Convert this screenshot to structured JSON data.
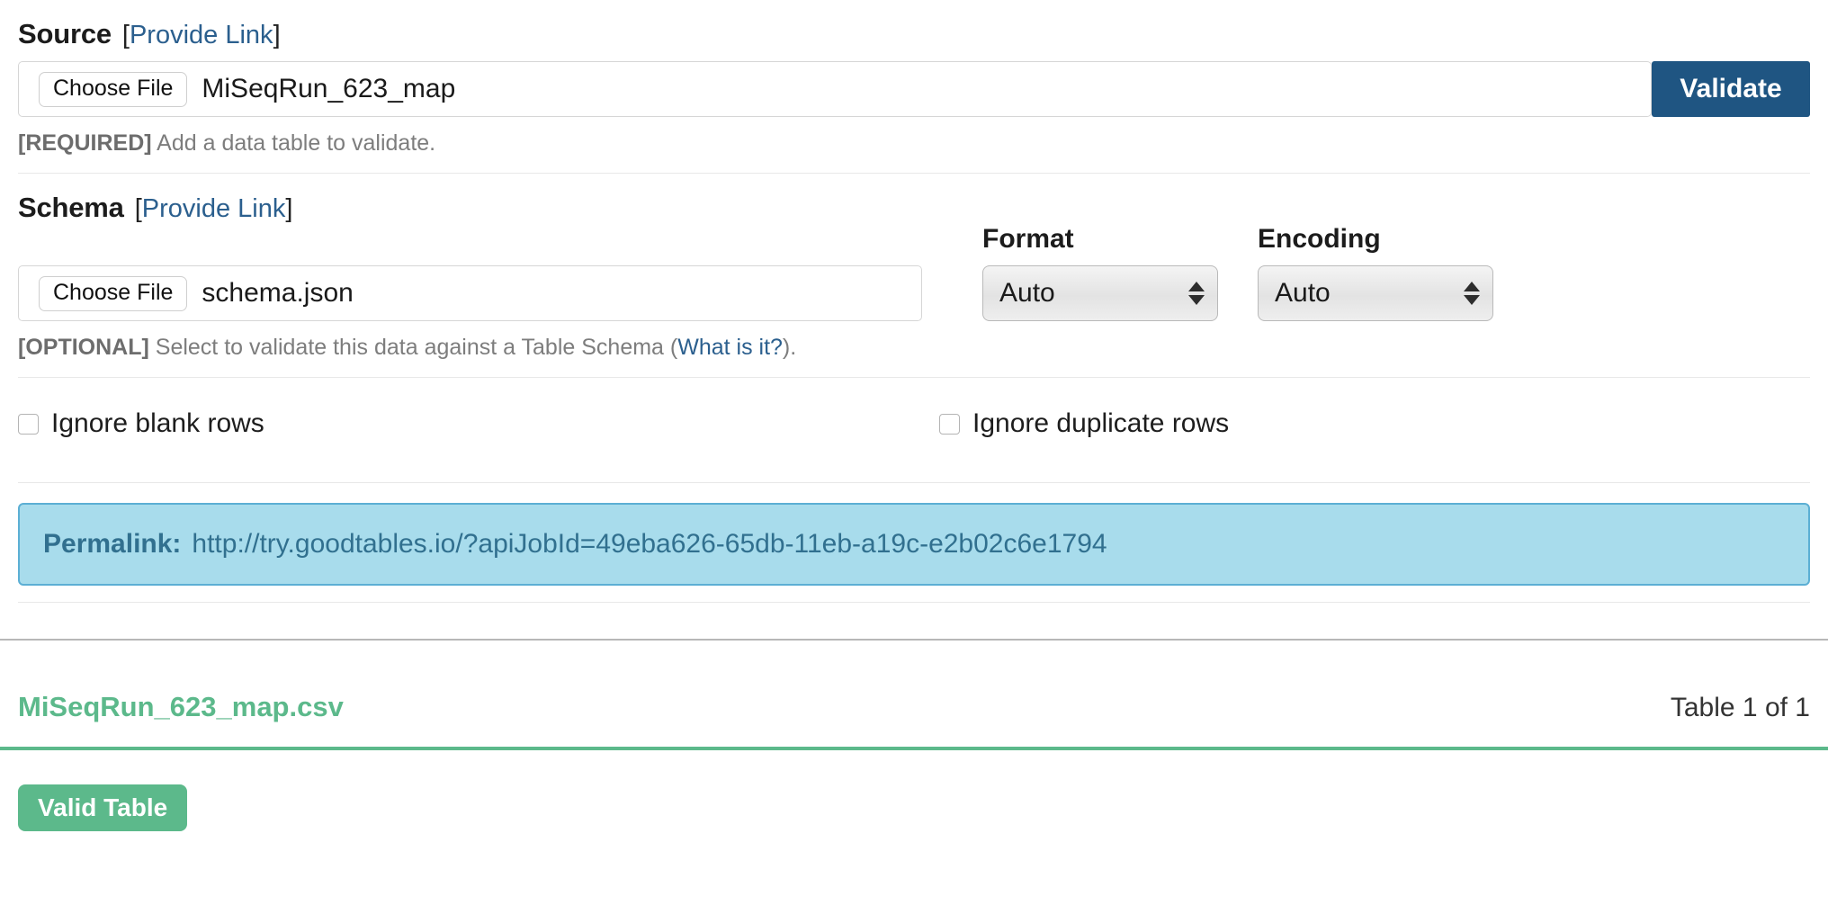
{
  "source": {
    "label": "Source",
    "provide_link": "Provide Link",
    "choose_file": "Choose File",
    "file_name": "MiSeqRun_623_map",
    "validate_label": "Validate",
    "helper_tag": "[REQUIRED]",
    "helper_text": " Add a data table to validate."
  },
  "schema": {
    "label": "Schema",
    "provide_link": "Provide Link",
    "choose_file": "Choose File",
    "file_name": "schema.json",
    "helper_tag": "[OPTIONAL]",
    "helper_text_before": " Select to validate this data against a Table Schema (",
    "helper_link": "What is it?",
    "helper_text_after": ")."
  },
  "format": {
    "label": "Format",
    "value": "Auto"
  },
  "encoding": {
    "label": "Encoding",
    "value": "Auto"
  },
  "options": {
    "ignore_blank_rows": "Ignore blank rows",
    "ignore_duplicate_rows": "Ignore duplicate rows"
  },
  "permalink": {
    "label": "Permalink:",
    "url": "http://try.goodtables.io/?apiJobId=49eba626-65db-11eb-a19c-e2b02c6e1794"
  },
  "results": {
    "table_file": "MiSeqRun_623_map.csv",
    "table_count": "Table 1 of 1",
    "status_badge": "Valid Table"
  },
  "colors": {
    "validate_button": "#1f5582",
    "link": "#2b5f8e",
    "success": "#5cb98b",
    "permalink_bg": "#a8dcec",
    "permalink_border": "#5cafd4",
    "permalink_text": "#31708f"
  }
}
